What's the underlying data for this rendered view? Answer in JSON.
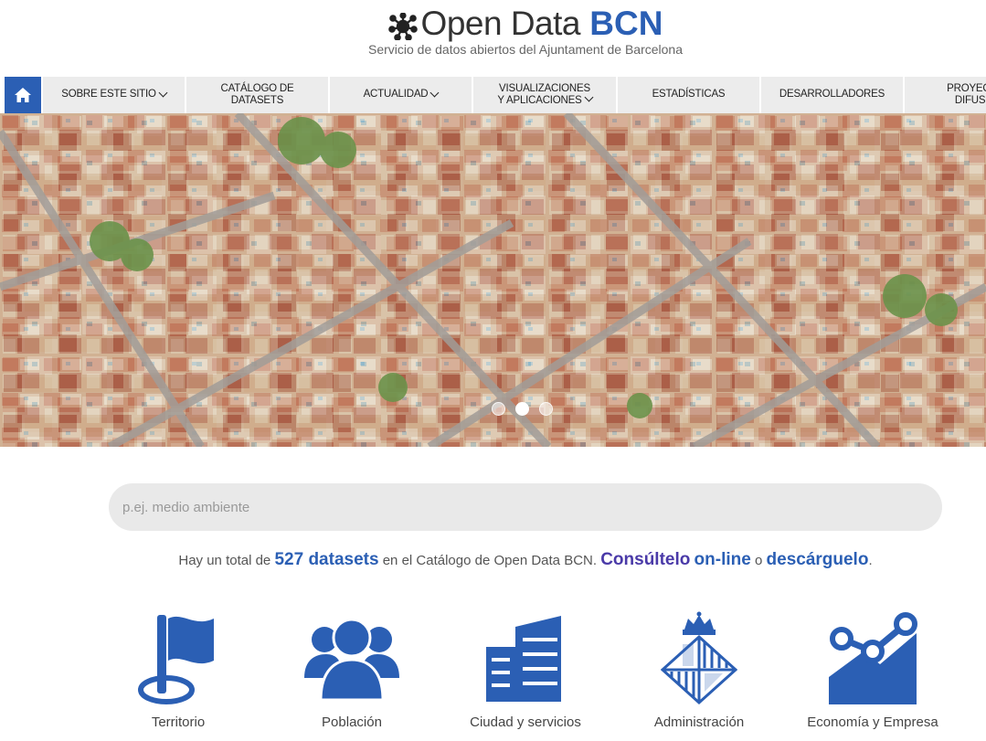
{
  "header": {
    "logo_light": "Open Data",
    "logo_bold": "BCN",
    "subtitle": "Servicio de datos abiertos del Ajuntament de Barcelona"
  },
  "nav": {
    "home_icon": "home-icon",
    "items": [
      {
        "label": "SOBRE ESTE SITIO",
        "has_dropdown": true
      },
      {
        "label": "CATÁLOGO DE DATASETS",
        "has_dropdown": false
      },
      {
        "label": "ACTUALIDAD",
        "has_dropdown": true
      },
      {
        "label": "VISUALIZACIONES Y APLICACIONES",
        "has_dropdown": true
      },
      {
        "label": "ESTADÍSTICAS",
        "has_dropdown": false
      },
      {
        "label": "DESARROLLADORES",
        "has_dropdown": false
      },
      {
        "label": "PROYECTO DIFUSIÓ",
        "has_dropdown": false
      }
    ]
  },
  "hero": {
    "slides": 3,
    "active_slide": 2
  },
  "search": {
    "placeholder": "p.ej. medio ambiente",
    "value": ""
  },
  "info": {
    "prefix": "Hay un total de",
    "count": "527",
    "datasets_word": "datasets",
    "middle": "en el Catálogo de Open Data BCN.",
    "consult": "Consúltelo",
    "online": "on-line",
    "or": "o",
    "download": "descárguelo",
    "end": "."
  },
  "categories": [
    {
      "label": "Territorio",
      "icon": "flag-icon"
    },
    {
      "label": "Población",
      "icon": "people-icon"
    },
    {
      "label": "Ciudad y servicios",
      "icon": "building-icon"
    },
    {
      "label": "Administración",
      "icon": "coat-of-arms-icon"
    },
    {
      "label": "Economía y Empresa",
      "icon": "trend-chart-icon"
    }
  ],
  "colors": {
    "brand_blue": "#2b5fb4",
    "link_purple": "#4a3aa8",
    "nav_bg": "#ececec"
  }
}
